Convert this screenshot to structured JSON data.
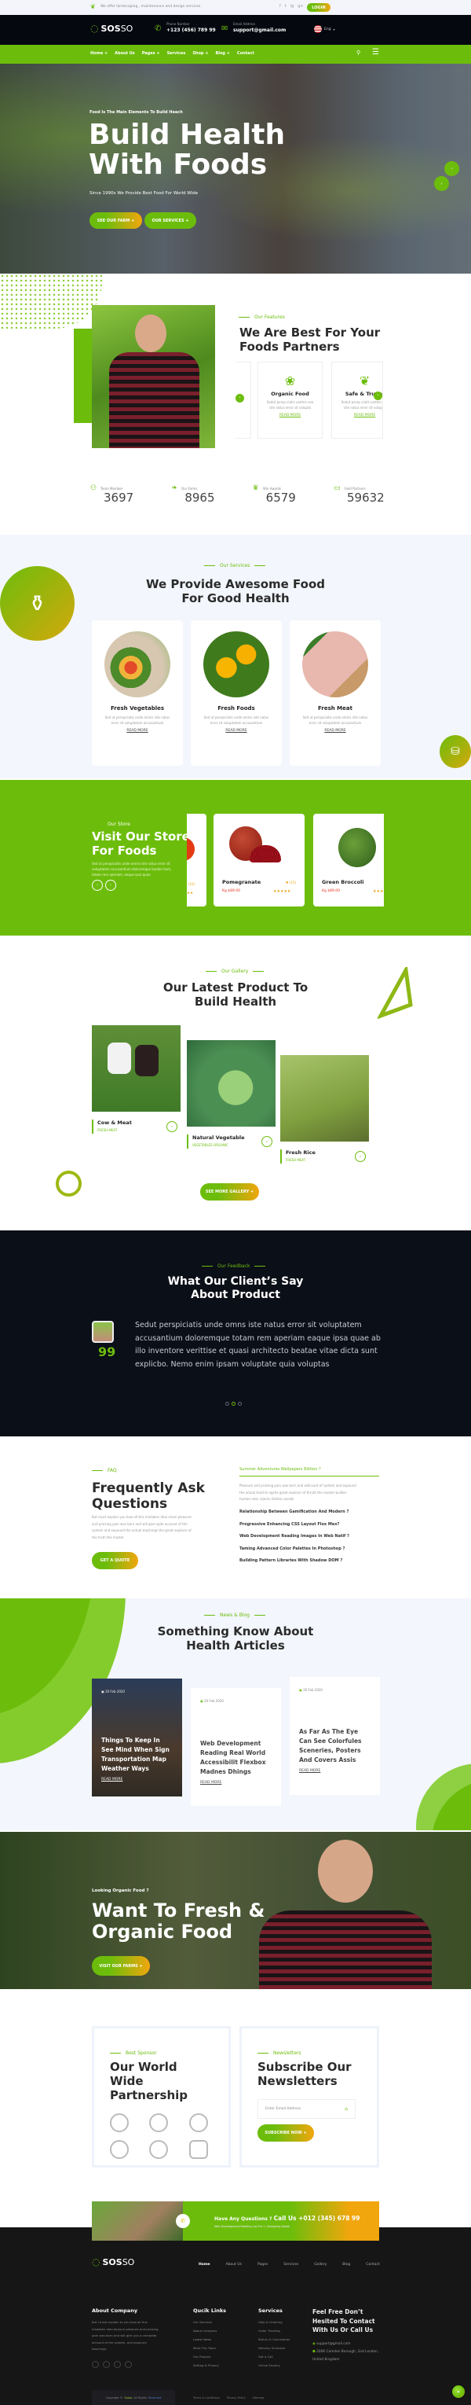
{
  "topbar": {
    "tagline": "We offer landscaping , maintenance and design services",
    "social": [
      "f",
      "t",
      "ig",
      "g+"
    ],
    "login_label": "LOGIN"
  },
  "header": {
    "logo_bold": "SOS",
    "logo_light": "SO",
    "phone_label": "Phone Number",
    "phone": "+123 (456) 789 99",
    "email_label": "Email Address",
    "email": "support@gmail.com",
    "lang": "Eng"
  },
  "nav": {
    "items": [
      "Home +",
      "About Us",
      "Pages +",
      "Services",
      "Shop +",
      "Blog +",
      "Contact"
    ]
  },
  "hero": {
    "kicker": "Food Is The Main Elements To Build Heach",
    "title_1": "Build Health",
    "title_2": "With Foods",
    "subtitle": "Since 1990s We Provide Best Food For World Wide",
    "btn1": "SEE OUR FARM +",
    "btn2": "OUR SERVICES +"
  },
  "features": {
    "kicker": "Our Features",
    "title_1": "We Are Best For Your",
    "title_2": "Foods Partners",
    "cards": [
      {
        "title": "Organic Food",
        "text": "Sedut persp ciatis undmn see iste natus error sit volupta",
        "link": "READ MORE"
      },
      {
        "title": "Safe & Trusty",
        "text": "Sedut persp ciatis undmn see iste natus error sit volupta",
        "link": "READ MORE"
      }
    ]
  },
  "stats": [
    {
      "label": "Team Member",
      "value": "3697"
    },
    {
      "label": "Our Farms",
      "value": "8965"
    },
    {
      "label": "Win Awards",
      "value": "6579"
    },
    {
      "label": "Gold Partners",
      "value": "59632"
    }
  ],
  "services": {
    "kicker": "Our Services",
    "title_1": "We Provide Awesome Food",
    "title_2": "For Good Health",
    "cards": [
      {
        "title": "Fresh Vegetables",
        "text": "Sed ut perspiciatis unde omnis iste natus error sit voluptatem accusantium",
        "link": "READ MORE"
      },
      {
        "title": "Fresh Foods",
        "text": "Sed ut perspiciatis unde omnis iste natus error sit voluptatem accusantium",
        "link": "READ MORE"
      },
      {
        "title": "Fresh Meat",
        "text": "Sed ut perspiciatis unde omnis iste natus error sit voluptatem accusantium",
        "link": "READ MORE"
      }
    ]
  },
  "store": {
    "kicker": "Our Store",
    "title_1": "Visit Our Store",
    "title_2": "For Foods",
    "text": "Sed ut perspiciatis unde omnis iste natus error sit voluptatem accusantium doloremque laudan tium, totam rem aperiam, eaque ipsa quae",
    "products": [
      {
        "name": "Pomegranate",
        "price": "Kg $89.00",
        "likes": "(15)"
      },
      {
        "name": "Green Broccoli",
        "price": "Kg $89.00",
        "likes": "(15)"
      }
    ],
    "partial_likes": "(15)"
  },
  "gallery": {
    "kicker": "Our Gallery",
    "title_1": "Our Latest Product To",
    "title_2": "Build Health",
    "items": [
      {
        "title": "Cow & Meat",
        "tag": "FRESH MEAT"
      },
      {
        "title": "Natural Vegetable",
        "tag": "VEGETABLES ORGANIC"
      },
      {
        "title": "Fresh Rice",
        "tag": "FRESH MEAT"
      }
    ],
    "btn": "SEE MORE GALLERY +"
  },
  "feedback": {
    "kicker": "Our Feedback",
    "title_1": "What Our Client’s Say",
    "title_2": "About Product",
    "quote": "Sedut perspiciatis unde omns iste natus error sit voluptatem accusantium doloremque totam rem aperiam eaque ipsa quae ab illo inventore verittise et quasi architecto beatae vitae dicta sunt explicbo. Nemo enim ipsam voluptate quia voluptas"
  },
  "faq": {
    "kicker": "FAQ",
    "title_1": "Frequently Ask",
    "title_2": "Questions",
    "text": "But must explain you how all this mistaken idea reson pleasure and praising pain was born and will give spite account of the system and expound the actual teachings the great explorer of the truth the master",
    "btn": "GET A QUOTE",
    "open_q": "Summer Adventures Wallpapers Edition ?",
    "open_a": "Pleasure and praising pain was born and willcount of system and expound the actual teachin egshe great explorer of thruth the master builder human ness rejects dislikes avoids",
    "questions": [
      "Relationship Between Gamification And Modern ?",
      "Progressive Enhancing CSS Layout Flox Mex?",
      "Web Development Reading Images In Web Natif ?",
      "Taming Advanced Color Palettes In Photoshop ?",
      "Building Pattern Libraries With Shadow DOM ?"
    ]
  },
  "blog": {
    "kicker": "News & Blog",
    "title_1": "Something Know About",
    "title_2": "Health Articles",
    "posts": [
      {
        "date": "20 Feb 2020",
        "title": "Things To Keep In See Mind When Sign Transportation Map Weather Ways",
        "link": "READ MORE"
      },
      {
        "date": "20 Feb 2020",
        "title": "Web Development Reading Real World Accessibilit Flexbox Madnes Dhings",
        "link": "READ MORE"
      },
      {
        "date": "20 Feb 2020",
        "title": "As Far As The Eye Can See Colorfules Sceneries, Posters And Covers Assis",
        "link": "READ MORE"
      }
    ]
  },
  "cta": {
    "kicker": "Looking Organic Food ?",
    "title_1": "Want To Fresh &",
    "title_2": "Organic Food",
    "btn": "VISIT OUR FARMS +"
  },
  "partners": {
    "kicker": "Best Sponsor",
    "title_1": "Our World Wide",
    "title_2": "Partnership"
  },
  "newsletter": {
    "kicker": "Newsletters",
    "title_1": "Subscribe Our",
    "title_2": "Newsletters",
    "placeholder": "Enter Email Address",
    "btn": "SUBSCRIBE NOW +"
  },
  "callbar": {
    "text": "Have Any Questions ?",
    "call": "Call Us +012 (345) 678 99",
    "sub": "Web Development Reading List For 1, Designing Depth"
  },
  "footer": {
    "nav": [
      "Home",
      "About Us",
      "Pages",
      "Services",
      "Gallery",
      "Blog",
      "Contact"
    ],
    "about_title": "About Company",
    "about_text": "But I must explain to you how all this mistaken idea denoun pleasure and praising pain was born and will give you a complete account of the system, and expound teachings",
    "links_title": "Qucik Links",
    "links": [
      "Our Services",
      "About Company",
      "Latest News",
      "Meet The Team",
      "Our Product",
      "Setting & Privacy"
    ],
    "services_title": "Services",
    "services": [
      "Help & Ordering",
      "Order Tracking",
      "Return & Cancelation",
      "Delivery Schedule",
      "Get a Call",
      "Online Enquiry"
    ],
    "contact_title": "Feel Free Don’t Hesited To Contact With Us Or Call Us",
    "email": "support@gmail.com",
    "address": "200K Camden Borough, 2nd London, United Kingdom",
    "copyright_pre": "Copyright ©",
    "brand": "Sosso",
    "copyright_mid": "All Rights",
    "copyright_end": "Reserved",
    "legal": [
      "Terms & Conditions",
      "Privacy Policy",
      "Sitemap"
    ]
  }
}
